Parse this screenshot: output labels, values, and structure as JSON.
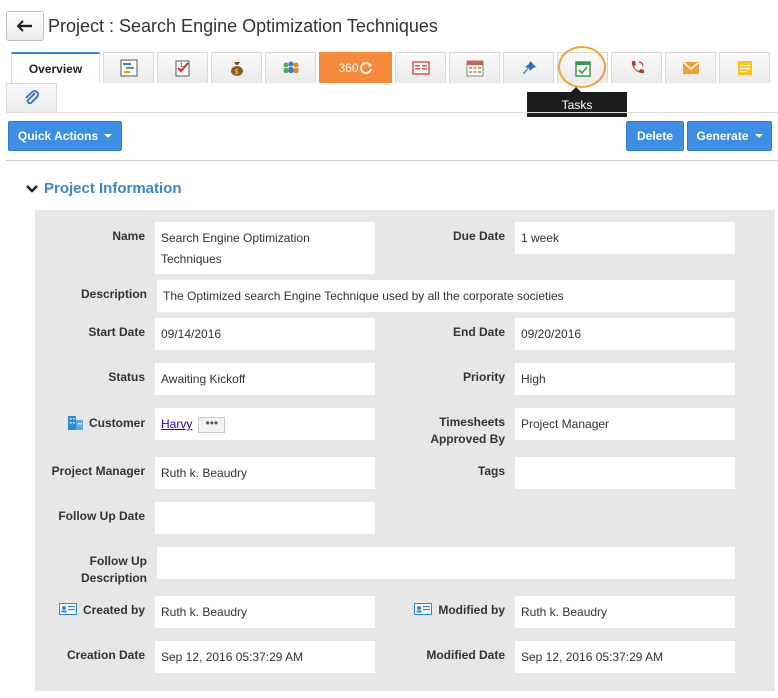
{
  "header": {
    "title": "Project : Search Engine Optimization Techniques",
    "back_icon": "arrow-left-icon"
  },
  "tabs": {
    "overview_label": "Overview",
    "label_360": "360",
    "icons": [
      "gantt-icon",
      "task-check-icon",
      "money-bag-icon",
      "team-icon",
      "360-refresh-icon",
      "report-icon",
      "calendar-icon",
      "pin-icon",
      "tasks-calendar-check-icon",
      "phone-icon",
      "mail-icon",
      "note-icon",
      "attachment-icon"
    ],
    "tooltip": "Tasks"
  },
  "actions": {
    "quick_actions": "Quick Actions",
    "delete": "Delete",
    "generate": "Generate"
  },
  "section": {
    "title": "Project Information"
  },
  "fields": {
    "name_label": "Name",
    "name_value": "Search Engine Optimization Techniques",
    "due_date_label": "Due Date",
    "due_date_value": "1 week",
    "description_label": "Description",
    "description_value": "The Optimized search Engine Technique used by all the corporate societies",
    "start_date_label": "Start Date",
    "start_date_value": "09/14/2016",
    "end_date_label": "End Date",
    "end_date_value": "09/20/2016",
    "status_label": "Status",
    "status_value": "Awaiting Kickoff",
    "priority_label": "Priority",
    "priority_value": "High",
    "customer_label": "Customer",
    "customer_value": "Harvy",
    "timesheets_label": "Timesheets Approved By",
    "timesheets_value": "Project Manager",
    "pm_label": "Project Manager",
    "pm_value": "Ruth k. Beaudry",
    "tags_label": "Tags",
    "tags_value": "",
    "followup_date_label": "Follow Up Date",
    "followup_date_value": "",
    "followup_desc_label": "Follow Up Description",
    "followup_desc_value": "",
    "created_by_label": "Created by",
    "created_by_value": "Ruth k. Beaudry",
    "modified_by_label": "Modified by",
    "modified_by_value": "Ruth k. Beaudry",
    "creation_date_label": "Creation Date",
    "creation_date_value": "Sep 12, 2016 05:37:29 AM",
    "modified_date_label": "Modified Date",
    "modified_date_value": "Sep 12, 2016 05:37:29 AM"
  },
  "colors": {
    "primary": "#3d8fe5",
    "accent_orange": "#f6893a",
    "section_title": "#3b87c9",
    "panel_bg": "#e7e7e7"
  }
}
